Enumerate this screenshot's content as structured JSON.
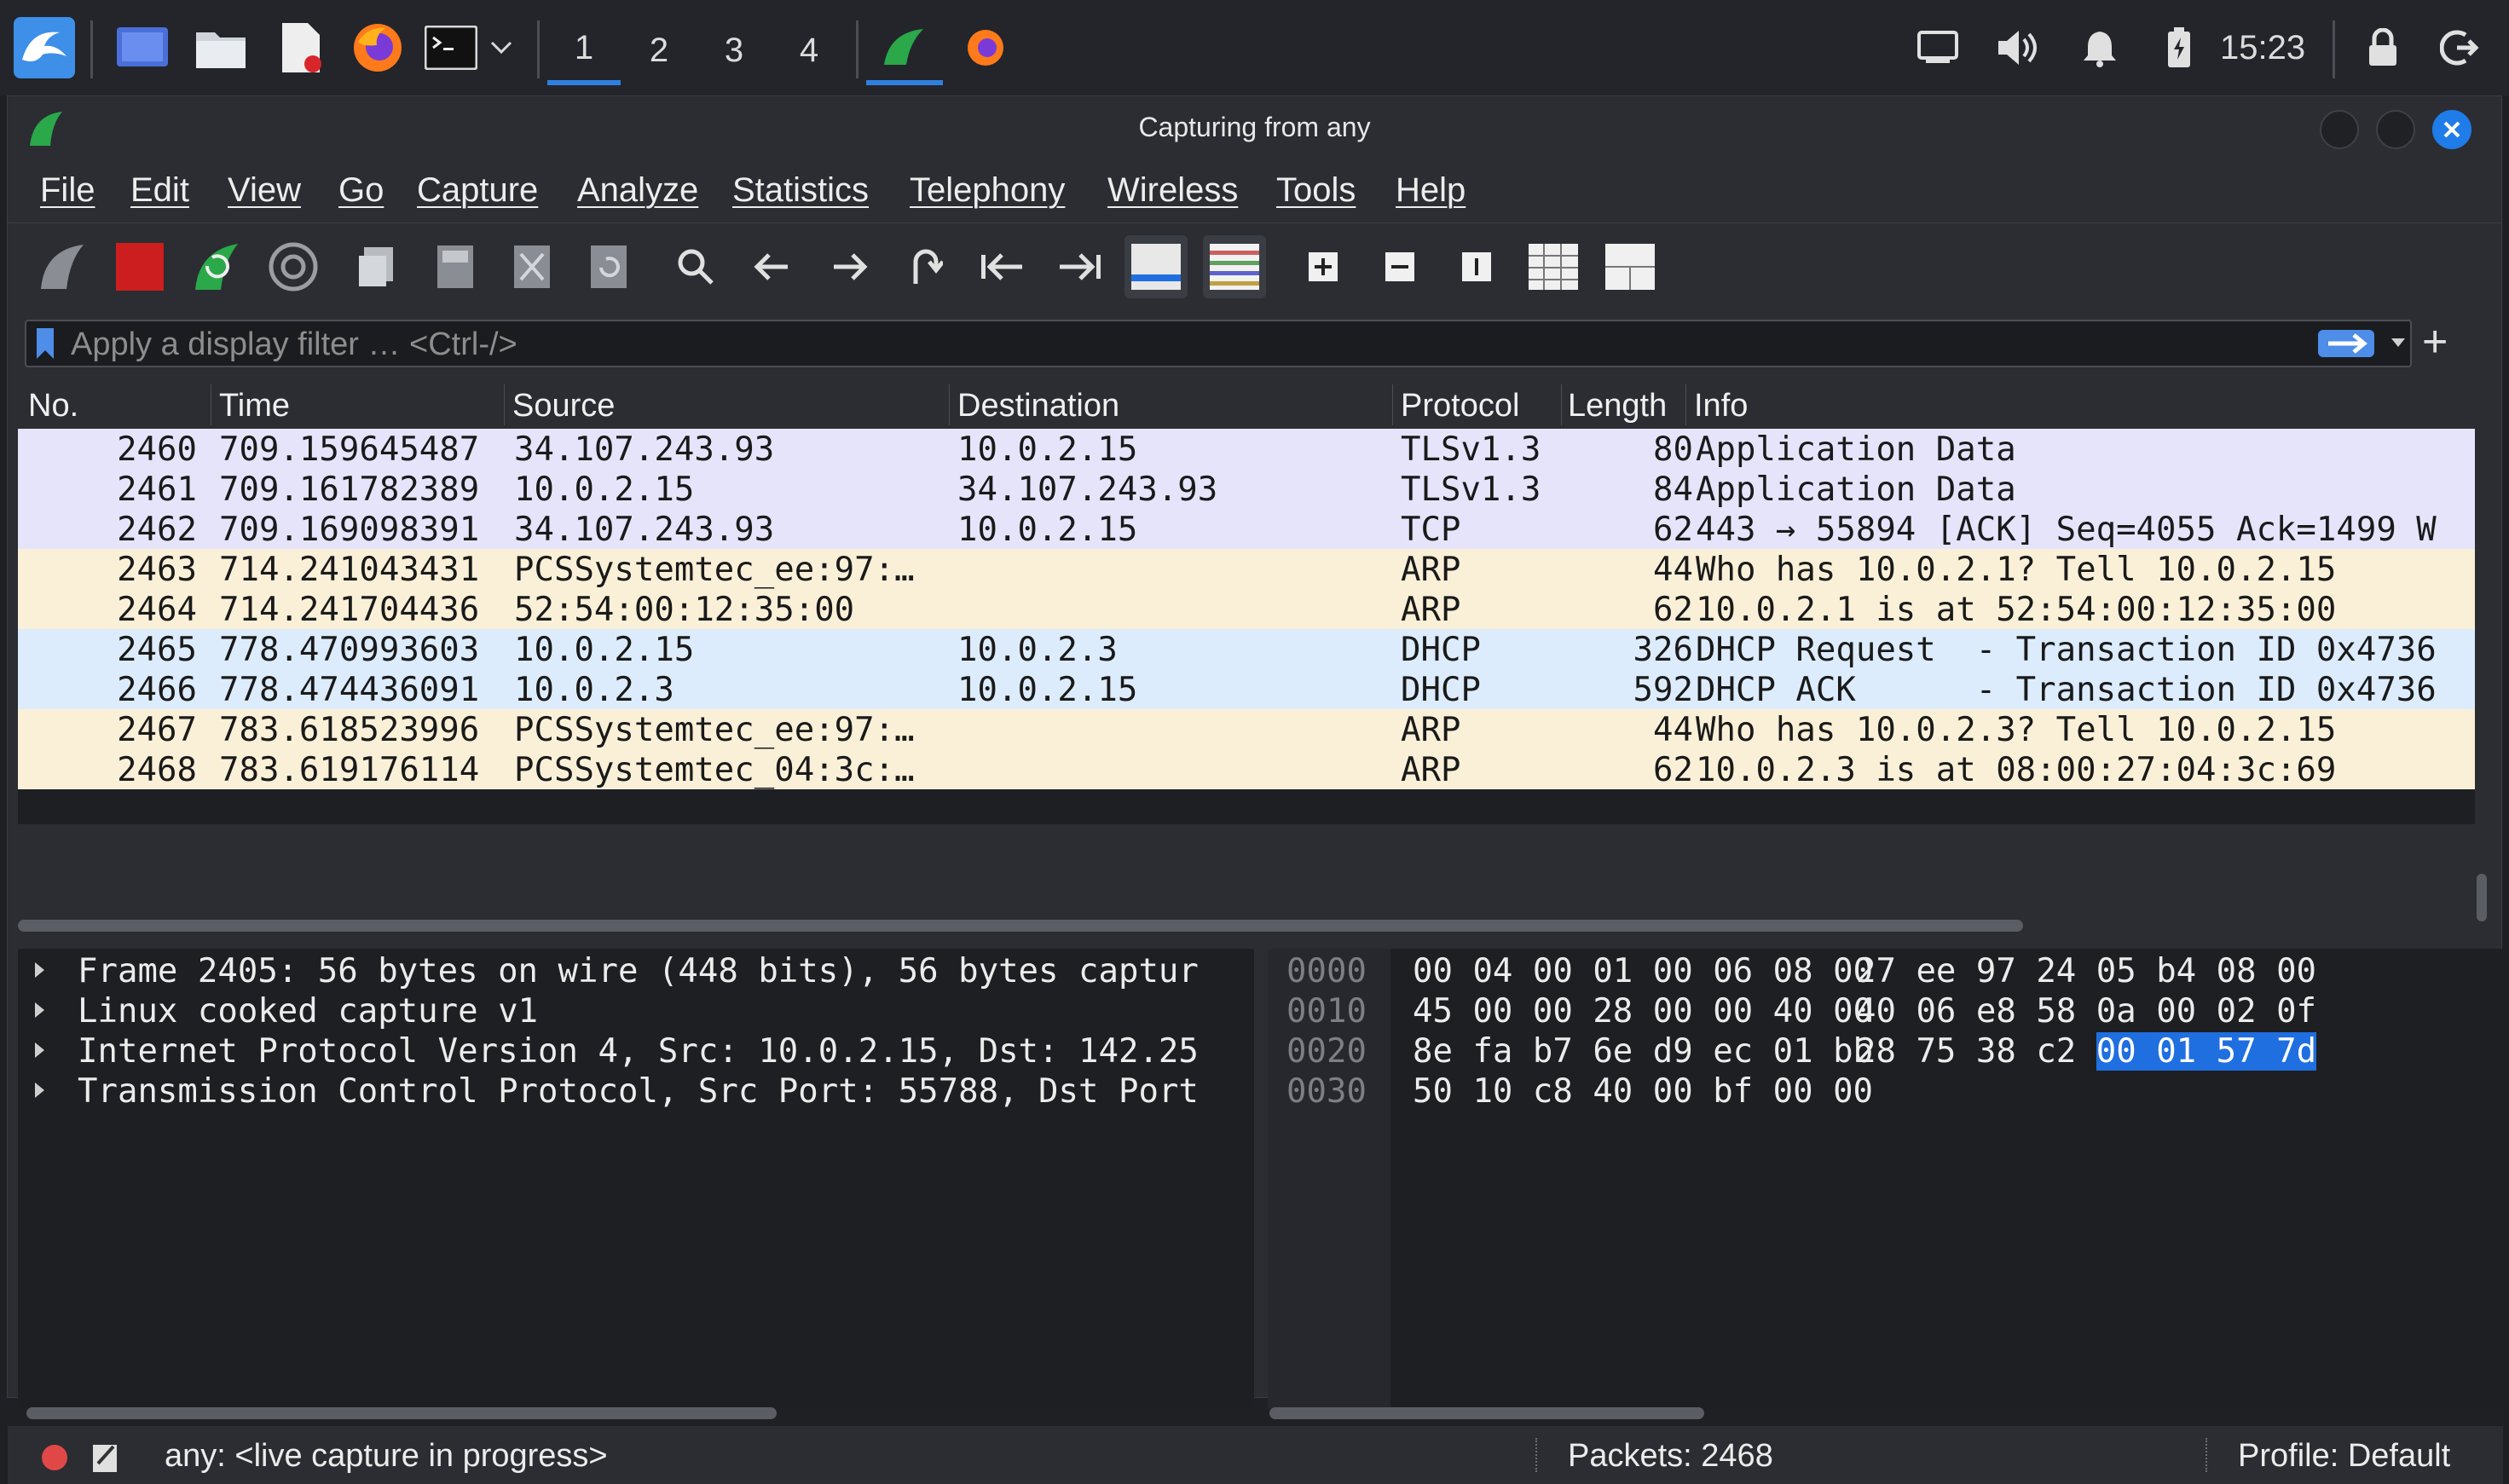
{
  "panel": {
    "workspaces": [
      "1",
      "2",
      "3",
      "4"
    ],
    "active_workspace": "1",
    "clock": "15:23"
  },
  "window": {
    "title": "Capturing from any"
  },
  "menu": [
    "File",
    "Edit",
    "View",
    "Go",
    "Capture",
    "Analyze",
    "Statistics",
    "Telephony",
    "Wireless",
    "Tools",
    "Help"
  ],
  "filter": {
    "placeholder": "Apply a display filter … <Ctrl-/>",
    "add_label": "+"
  },
  "columns": [
    "No.",
    "Time",
    "Source",
    "Destination",
    "Protocol",
    "Length",
    "Info"
  ],
  "colors": {
    "tcp": "#e6e4fb",
    "arp": "#faf0d8",
    "dhcp": "#dcecfc",
    "selection": "#1f6fe0",
    "capture_stop": "#cc1e1e",
    "shark_fin": "#2aa84a"
  },
  "packets": [
    {
      "no": "2460",
      "time": "709.159645487",
      "src": "34.107.243.93",
      "dst": "10.0.2.15",
      "proto": "TLSv1.3",
      "len": "80",
      "info": "Application Data",
      "cls": "tcp"
    },
    {
      "no": "2461",
      "time": "709.161782389",
      "src": "10.0.2.15",
      "dst": "34.107.243.93",
      "proto": "TLSv1.3",
      "len": "84",
      "info": "Application Data",
      "cls": "tcp"
    },
    {
      "no": "2462",
      "time": "709.169098391",
      "src": "34.107.243.93",
      "dst": "10.0.2.15",
      "proto": "TCP",
      "len": "62",
      "info": "443 → 55894 [ACK] Seq=4055 Ack=1499 W",
      "cls": "tcp"
    },
    {
      "no": "2463",
      "time": "714.241043431",
      "src": "PCSSystemtec_ee:97:…",
      "dst": "",
      "proto": "ARP",
      "len": "44",
      "info": "Who has 10.0.2.1? Tell 10.0.2.15",
      "cls": "arp"
    },
    {
      "no": "2464",
      "time": "714.241704436",
      "src": "52:54:00:12:35:00",
      "dst": "",
      "proto": "ARP",
      "len": "62",
      "info": "10.0.2.1 is at 52:54:00:12:35:00",
      "cls": "arp"
    },
    {
      "no": "2465",
      "time": "778.470993603",
      "src": "10.0.2.15",
      "dst": "10.0.2.3",
      "proto": "DHCP",
      "len": "326",
      "info": "DHCP Request  - Transaction ID 0x4736",
      "cls": "dhcp"
    },
    {
      "no": "2466",
      "time": "778.474436091",
      "src": "10.0.2.3",
      "dst": "10.0.2.15",
      "proto": "DHCP",
      "len": "592",
      "info": "DHCP ACK      - Transaction ID 0x4736",
      "cls": "dhcp"
    },
    {
      "no": "2467",
      "time": "783.618523996",
      "src": "PCSSystemtec_ee:97:…",
      "dst": "",
      "proto": "ARP",
      "len": "44",
      "info": "Who has 10.0.2.3? Tell 10.0.2.15",
      "cls": "arp"
    },
    {
      "no": "2468",
      "time": "783.619176114",
      "src": "PCSSystemtec_04:3c:…",
      "dst": "",
      "proto": "ARP",
      "len": "62",
      "info": "10.0.2.3 is at 08:00:27:04:3c:69",
      "cls": "arp"
    }
  ],
  "details": [
    "Frame 2405: 56 bytes on wire (448 bits), 56 bytes captur",
    "Linux cooked capture v1",
    "Internet Protocol Version 4, Src: 10.0.2.15, Dst: 142.25",
    "Transmission Control Protocol, Src Port: 55788, Dst Port"
  ],
  "bytes": [
    {
      "off": "0000",
      "hex1": "00 04 00 01 00 06 08 00",
      "hex2": "27 ee 97 24 05 b4 08 00",
      "hl": ""
    },
    {
      "off": "0010",
      "hex1": "45 00 00 28 00 00 40 00",
      "hex2": "40 06 e8 58 0a 00 02 0f",
      "hl": ""
    },
    {
      "off": "0020",
      "hex1": "8e fa b7 6e d9 ec 01 bb",
      "hex2": "28 75 38 c2",
      "hl": "00 01 57 7d"
    },
    {
      "off": "0030",
      "hex1": "50 10 c8 40 00 bf 00 00",
      "hex2": "",
      "hl": ""
    }
  ],
  "status": {
    "interface": "any: <live capture in progress>",
    "packets": "Packets: 2468",
    "profile": "Profile: Default"
  }
}
